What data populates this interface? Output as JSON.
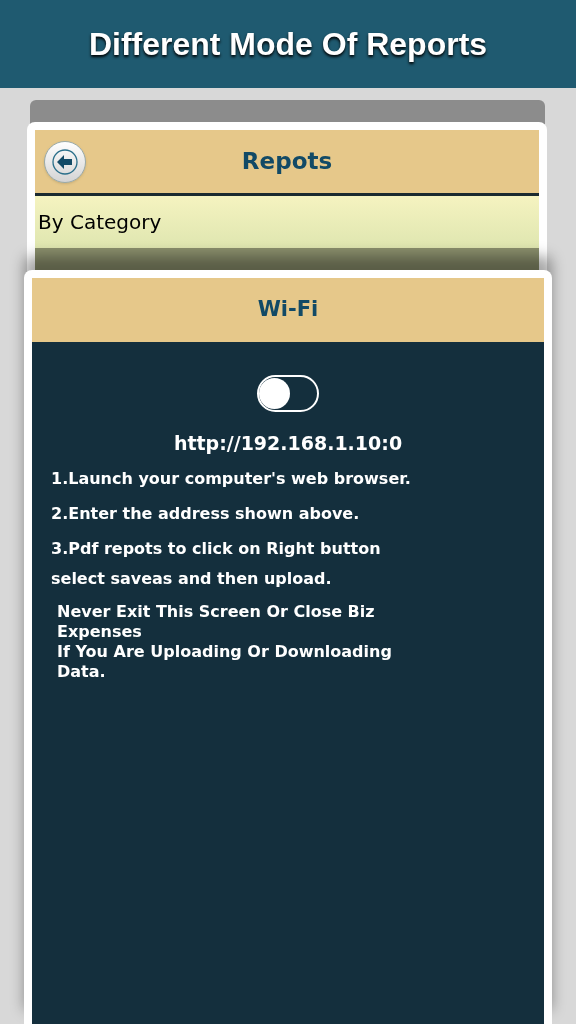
{
  "banner": {
    "title": "Different Mode Of Reports"
  },
  "reports_screen": {
    "title": "Repots",
    "rows": [
      "By Category"
    ]
  },
  "wifi_panel": {
    "title": "Wi-Fi",
    "wifi_toggle": {
      "on": false
    },
    "address": "http://192.168.1.10:0",
    "steps": [
      "1.Launch your computer's web browser.",
      "2.Enter the address shown above.",
      "3.Pdf repots to click on Right button select saveas and then upload."
    ],
    "warning": [
      "Never Exit This Screen Or Close Biz Expenses",
      "If You Are Uploading Or Downloading Data."
    ]
  }
}
